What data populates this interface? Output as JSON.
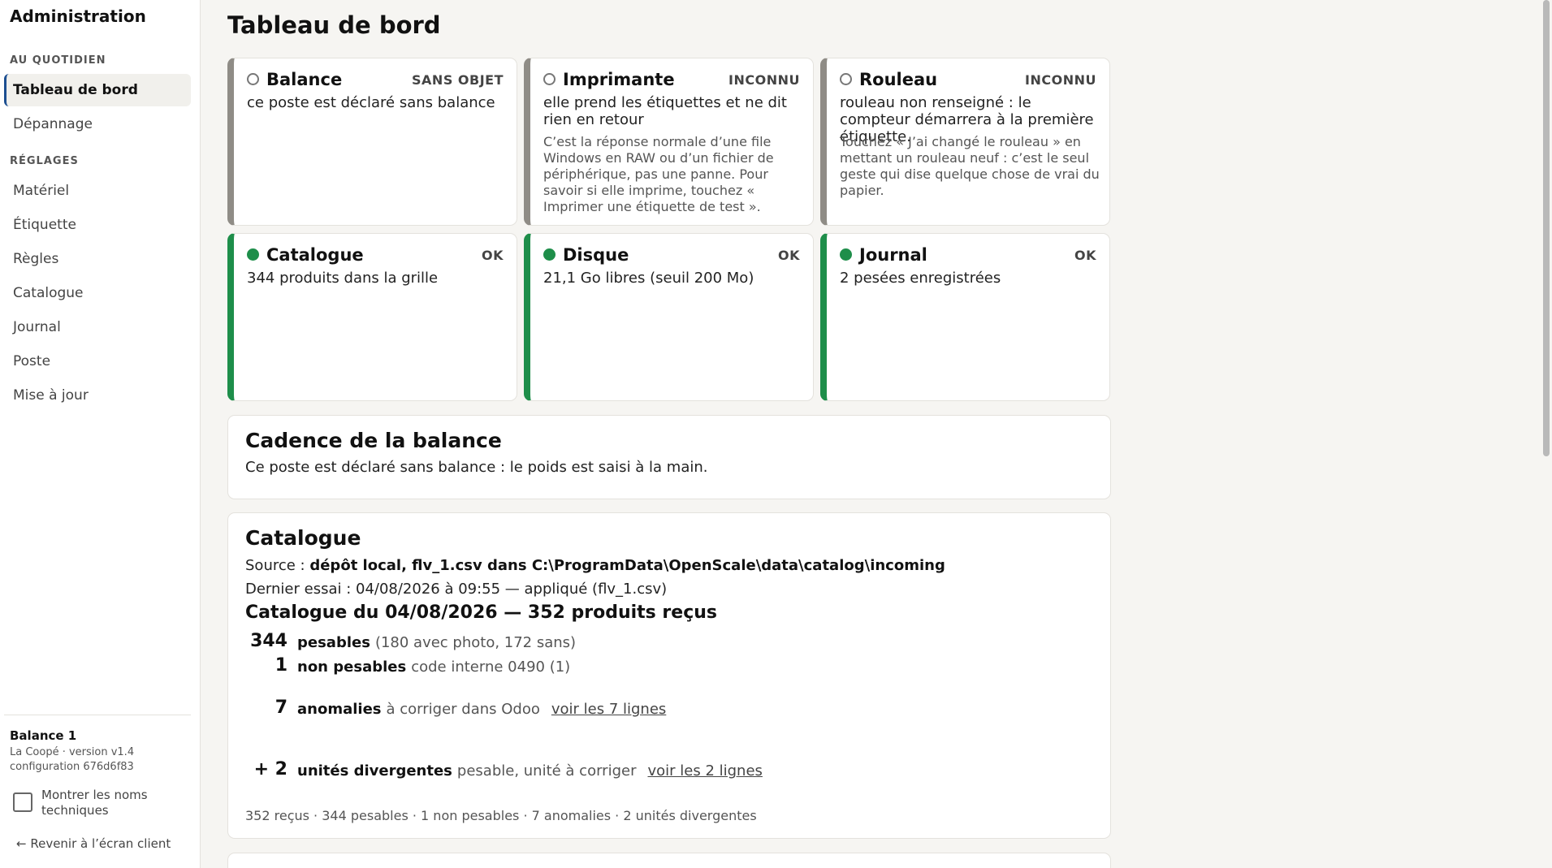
{
  "sidebar": {
    "brand": "Administration",
    "sections": [
      {
        "label": "AU QUOTIDIEN",
        "items": [
          {
            "label": "Tableau de bord",
            "active": true
          },
          {
            "label": "Dépannage"
          }
        ]
      },
      {
        "label": "RÉGLAGES",
        "items": [
          {
            "label": "Matériel"
          },
          {
            "label": "Étiquette"
          },
          {
            "label": "Règles"
          },
          {
            "label": "Catalogue"
          },
          {
            "label": "Journal"
          },
          {
            "label": "Poste"
          },
          {
            "label": "Mise à jour"
          }
        ]
      }
    ],
    "station": {
      "name": "Balance 1",
      "meta_line1": "La Coopé · version v1.4",
      "meta_line2": "configuration 676d6f83"
    },
    "tech_names_label": "Montrer les noms techniques",
    "back_link": "← Revenir à l’écran client"
  },
  "main": {
    "title": "Tableau de bord",
    "cards": [
      {
        "title": "Balance",
        "badge": "SANS OBJET",
        "status": "unknown",
        "desc": "ce poste est déclaré sans balance",
        "note": ""
      },
      {
        "title": "Imprimante",
        "badge": "INCONNU",
        "status": "unknown",
        "desc": "elle prend les étiquettes et ne dit rien en retour",
        "note": "C’est la réponse normale d’une file Windows en RAW ou d’un fichier de périphérique, pas une panne. Pour savoir si elle imprime, touchez « Imprimer une étiquette de test »."
      },
      {
        "title": "Rouleau",
        "badge": "INCONNU",
        "status": "unknown",
        "desc": "rouleau non renseigné : le compteur démarrera à la première étiquette.",
        "note": "Touchez « J’ai changé le rouleau » en mettant un rouleau neuf : c’est le seul geste qui dise quelque chose de vrai du papier."
      },
      {
        "title": "Catalogue",
        "badge": "OK",
        "status": "ok",
        "desc": "344 produits dans la grille",
        "note": ""
      },
      {
        "title": "Disque",
        "badge": "OK",
        "status": "ok",
        "desc": "21,1 Go libres (seuil 200 Mo)",
        "note": ""
      },
      {
        "title": "Journal",
        "badge": "OK",
        "status": "ok",
        "desc": "2 pesées enregistrées",
        "note": ""
      }
    ],
    "cadence": {
      "title": "Cadence de la balance",
      "text": "Ce poste est déclaré sans balance : le poids est saisi à la main."
    },
    "catalogue": {
      "title": "Catalogue",
      "source_label": "Source : ",
      "source_value": "dépôt local, flv_1.csv dans C:\\ProgramData\\OpenScale\\data\\catalog\\incoming",
      "last_try": "Dernier essai : 04/08/2026 à 09:55 — appliqué (flv_1.csv)",
      "heading": "Catalogue du 04/08/2026 — 352 produits reçus",
      "stats": [
        {
          "num": "344",
          "label": "pesables",
          "detail": "(180 avec photo, 172 sans)",
          "link": ""
        },
        {
          "num": "1",
          "label": "non pesables",
          "detail": "code interne 0490 (1)",
          "link": ""
        },
        {
          "num": "7",
          "label": "anomalies",
          "detail": "à corriger dans Odoo",
          "link": "voir les 7 lignes"
        },
        {
          "num": "+ 2",
          "label": "unités divergentes",
          "detail": "pesable, unité à corriger",
          "link": "voir les 2 lignes"
        }
      ],
      "summary": "352 reçus · 344 pesables · 1 non pesables · 7 anomalies · 2 unités divergentes"
    }
  }
}
